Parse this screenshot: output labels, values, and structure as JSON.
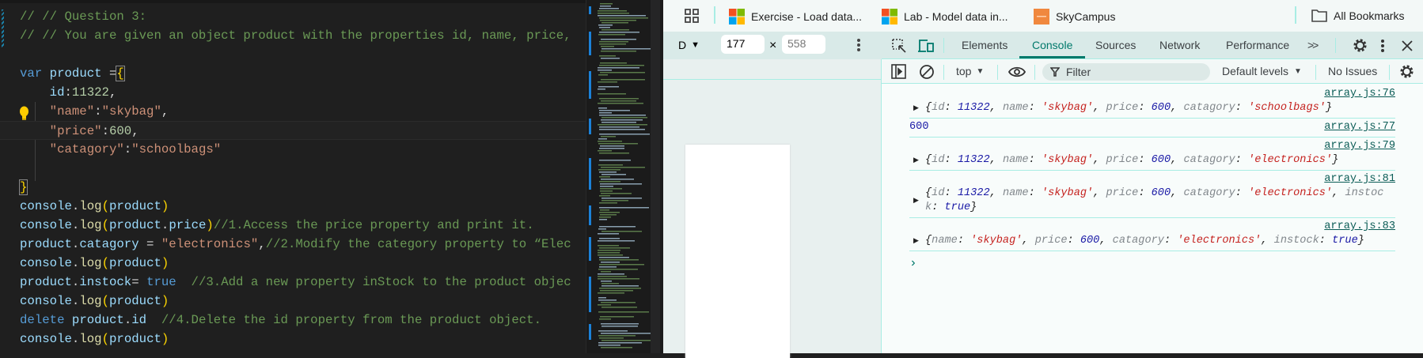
{
  "editor": {
    "lines": [
      [
        [
          "// // Question 3:",
          "com"
        ]
      ],
      [
        [
          "// // You are given an object product with the properties id, name, price,",
          "com"
        ]
      ],
      [],
      [
        [
          "var",
          "kw"
        ],
        [
          " ",
          "op"
        ],
        [
          "product",
          "var"
        ],
        [
          " =",
          "op"
        ],
        [
          "{",
          "br2"
        ]
      ],
      [
        [
          "    ",
          "op"
        ],
        [
          "id",
          "var"
        ],
        [
          ":",
          "op"
        ],
        [
          "11322",
          "num"
        ],
        [
          ",",
          "op"
        ]
      ],
      [
        [
          "    ",
          "op"
        ],
        [
          "\"name\"",
          "str"
        ],
        [
          ":",
          "op"
        ],
        [
          "\"skybag\"",
          "str"
        ],
        [
          ",",
          "op"
        ]
      ],
      [
        [
          "    ",
          "op"
        ],
        [
          "\"price\"",
          "str"
        ],
        [
          ":",
          "op"
        ],
        [
          "600",
          "num"
        ],
        [
          ",",
          "op"
        ]
      ],
      [
        [
          "    ",
          "op"
        ],
        [
          "\"catagory\"",
          "str"
        ],
        [
          ":",
          "op"
        ],
        [
          "\"schoolbags\"",
          "str"
        ]
      ],
      [],
      [
        [
          "}",
          "br2"
        ]
      ],
      [
        [
          "console",
          "var"
        ],
        [
          ".",
          "op"
        ],
        [
          "log",
          "fn"
        ],
        [
          "(",
          "br"
        ],
        [
          "product",
          "var"
        ],
        [
          ")",
          "br"
        ]
      ],
      [
        [
          "console",
          "var"
        ],
        [
          ".",
          "op"
        ],
        [
          "log",
          "fn"
        ],
        [
          "(",
          "br"
        ],
        [
          "product",
          "var"
        ],
        [
          ".",
          "op"
        ],
        [
          "price",
          "var"
        ],
        [
          ")",
          "br"
        ],
        [
          "//1.Access the price property and print it.",
          "com"
        ]
      ],
      [
        [
          "product",
          "var"
        ],
        [
          ".",
          "op"
        ],
        [
          "catagory",
          "var"
        ],
        [
          " = ",
          "op"
        ],
        [
          "\"electronics\"",
          "str"
        ],
        [
          ",",
          "op"
        ],
        [
          "//2.Modify the category property to “Elec",
          "com"
        ]
      ],
      [
        [
          "console",
          "var"
        ],
        [
          ".",
          "op"
        ],
        [
          "log",
          "fn"
        ],
        [
          "(",
          "br"
        ],
        [
          "product",
          "var"
        ],
        [
          ")",
          "br"
        ]
      ],
      [
        [
          "product",
          "var"
        ],
        [
          ".",
          "op"
        ],
        [
          "instock",
          "var"
        ],
        [
          "= ",
          "op"
        ],
        [
          "true",
          "kw"
        ],
        [
          "  //3.Add a new property inStock to the product objec",
          "com"
        ]
      ],
      [
        [
          "console",
          "var"
        ],
        [
          ".",
          "op"
        ],
        [
          "log",
          "fn"
        ],
        [
          "(",
          "br"
        ],
        [
          "product",
          "var"
        ],
        [
          ")",
          "br"
        ]
      ],
      [
        [
          "delete",
          "kw"
        ],
        [
          " ",
          "op"
        ],
        [
          "product",
          "var"
        ],
        [
          ".",
          "op"
        ],
        [
          "id",
          "var"
        ],
        [
          "  //4.Delete the id property from the product object.",
          "com"
        ]
      ],
      [
        [
          "console",
          "var"
        ],
        [
          ".",
          "op"
        ],
        [
          "log",
          "fn"
        ],
        [
          "(",
          "br"
        ],
        [
          "product",
          "var"
        ],
        [
          ")",
          "br"
        ]
      ]
    ],
    "lightbulb_icon": "lightbulb-icon"
  },
  "bookmarks": {
    "apps_icon": "grid-icon",
    "items": [
      {
        "label": "Exercise - Load data...",
        "icon": "microsoft-logo"
      },
      {
        "label": "Lab - Model data in...",
        "icon": "microsoft-logo"
      },
      {
        "label": "SkyCampus",
        "icon": "skycampus-logo"
      }
    ],
    "all_bookmarks": "All Bookmarks"
  },
  "device_toolbar": {
    "device": "D",
    "width": "177",
    "times": "×",
    "height": "558"
  },
  "devtools": {
    "tabs": [
      "Elements",
      "Console",
      "Sources",
      "Network",
      "Performance"
    ],
    "active_tab": "Console",
    "more": ">>",
    "context": "top",
    "filter_placeholder": "Filter",
    "levels": "Default levels",
    "issues": "No Issues"
  },
  "console": {
    "entries": [
      {
        "source": "array.js:76",
        "expandable": true,
        "tokens": [
          [
            "{",
            "p"
          ],
          [
            "id",
            "k"
          ],
          [
            ": ",
            "p"
          ],
          [
            "11322",
            "n"
          ],
          [
            ", ",
            "p"
          ],
          [
            "name",
            "k"
          ],
          [
            ": ",
            "p"
          ],
          [
            "'skybag'",
            "s"
          ],
          [
            ", ",
            "p"
          ],
          [
            "price",
            "k"
          ],
          [
            ": ",
            "p"
          ],
          [
            "600",
            "n"
          ],
          [
            ", ",
            "p"
          ],
          [
            "catagory",
            "k"
          ],
          [
            ": ",
            "p"
          ],
          [
            "'schoolbags'",
            "s"
          ],
          [
            "}",
            "p"
          ]
        ]
      },
      {
        "source": "array.js:77",
        "expandable": false,
        "tokens": [
          [
            "600",
            "plain"
          ]
        ]
      },
      {
        "source": "array.js:79",
        "expandable": true,
        "tokens": [
          [
            "{",
            "p"
          ],
          [
            "id",
            "k"
          ],
          [
            ": ",
            "p"
          ],
          [
            "11322",
            "n"
          ],
          [
            ", ",
            "p"
          ],
          [
            "name",
            "k"
          ],
          [
            ": ",
            "p"
          ],
          [
            "'skybag'",
            "s"
          ],
          [
            ", ",
            "p"
          ],
          [
            "price",
            "k"
          ],
          [
            ": ",
            "p"
          ],
          [
            "600",
            "n"
          ],
          [
            ", ",
            "p"
          ],
          [
            "catagory",
            "k"
          ],
          [
            ": ",
            "p"
          ],
          [
            "'electronics'",
            "s"
          ],
          [
            "}",
            "p"
          ]
        ]
      },
      {
        "source": "array.js:81",
        "expandable": true,
        "tokens": [
          [
            "{",
            "p"
          ],
          [
            "id",
            "k"
          ],
          [
            ": ",
            "p"
          ],
          [
            "11322",
            "n"
          ],
          [
            ", ",
            "p"
          ],
          [
            "name",
            "k"
          ],
          [
            ": ",
            "p"
          ],
          [
            "'skybag'",
            "s"
          ],
          [
            ", ",
            "p"
          ],
          [
            "price",
            "k"
          ],
          [
            ": ",
            "p"
          ],
          [
            "600",
            "n"
          ],
          [
            ", ",
            "p"
          ],
          [
            "catagory",
            "k"
          ],
          [
            ": ",
            "p"
          ],
          [
            "'electronics'",
            "s"
          ],
          [
            ", ",
            "p"
          ],
          [
            "instock",
            "k"
          ],
          [
            ": ",
            "p"
          ],
          [
            "true",
            "n"
          ],
          [
            "}",
            "p"
          ]
        ]
      },
      {
        "source": "array.js:83",
        "expandable": true,
        "tokens": [
          [
            "{",
            "p"
          ],
          [
            "name",
            "k"
          ],
          [
            ": ",
            "p"
          ],
          [
            "'skybag'",
            "s"
          ],
          [
            ", ",
            "p"
          ],
          [
            "price",
            "k"
          ],
          [
            ": ",
            "p"
          ],
          [
            "600",
            "n"
          ],
          [
            ", ",
            "p"
          ],
          [
            "catagory",
            "k"
          ],
          [
            ": ",
            "p"
          ],
          [
            "'electronics'",
            "s"
          ],
          [
            ", ",
            "p"
          ],
          [
            "instock",
            "k"
          ],
          [
            ": ",
            "p"
          ],
          [
            "true",
            "n"
          ],
          [
            "}",
            "p"
          ]
        ]
      }
    ],
    "prompt": "›"
  },
  "colors": {
    "accent": "#00796b",
    "editor_bg": "#1f1f1f",
    "separator": "#a8ede4"
  }
}
